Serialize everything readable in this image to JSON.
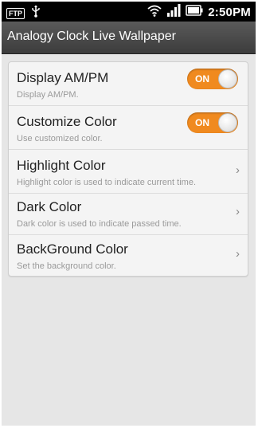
{
  "statusbar": {
    "ftp_label": "FTP",
    "time": "2:50PM",
    "icons": [
      "ftp-icon",
      "usb-icon",
      "wifi-icon",
      "signal-icon",
      "battery-icon"
    ]
  },
  "titlebar": {
    "title": "Analogy Clock Live Wallpaper"
  },
  "settings": {
    "items": [
      {
        "title": "Display AM/PM",
        "subtitle": "Display AM/PM.",
        "toggle": "ON"
      },
      {
        "title": "Customize Color",
        "subtitle": "Use customized color.",
        "toggle": "ON"
      },
      {
        "title": "Highlight Color",
        "subtitle": "Highlight color is used to indicate current time."
      },
      {
        "title": "Dark Color",
        "subtitle": "Dark color is used to indicate passed time."
      },
      {
        "title": "BackGround Color",
        "subtitle": "Set the background color."
      }
    ]
  },
  "colors": {
    "toggle_on": "#f08a1f",
    "titlebar": "#4a4a4a",
    "background": "#e6e6e6"
  }
}
